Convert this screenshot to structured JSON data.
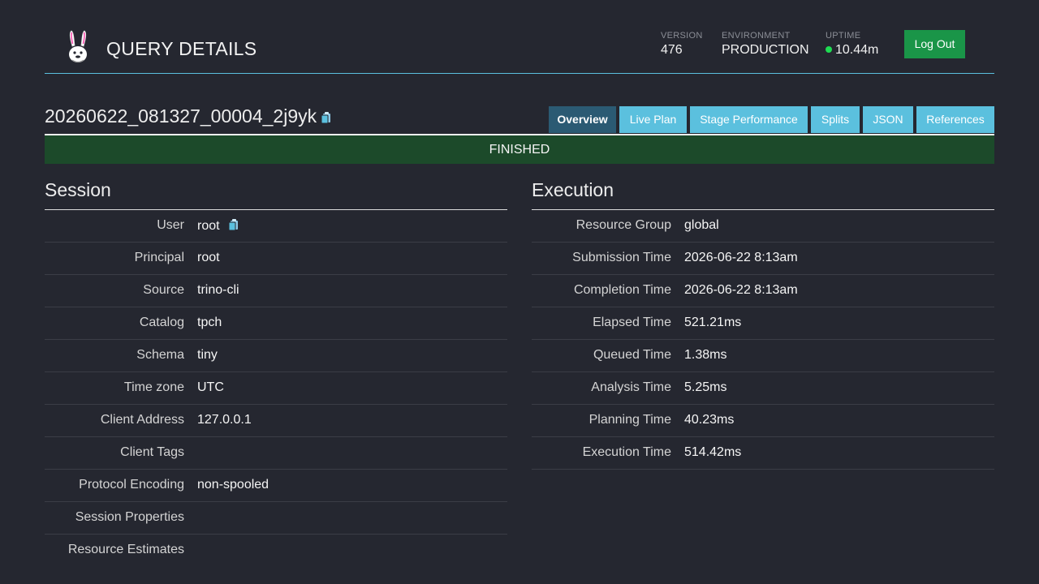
{
  "header": {
    "title": "QUERY DETAILS",
    "version_label": "VERSION",
    "version": "476",
    "environment_label": "ENVIRONMENT",
    "environment": "PRODUCTION",
    "uptime_label": "UPTIME",
    "uptime": "10.44m",
    "logout_label": "Log Out"
  },
  "query": {
    "id": "20260622_081327_00004_2j9yk",
    "state": "FINISHED"
  },
  "tabs": [
    {
      "label": "Overview",
      "active": true
    },
    {
      "label": "Live Plan",
      "active": false
    },
    {
      "label": "Stage Performance",
      "active": false
    },
    {
      "label": "Splits",
      "active": false
    },
    {
      "label": "JSON",
      "active": false
    },
    {
      "label": "References",
      "active": false
    }
  ],
  "session": {
    "title": "Session",
    "rows": [
      {
        "label": "User",
        "value": "root"
      },
      {
        "label": "Principal",
        "value": "root"
      },
      {
        "label": "Source",
        "value": "trino-cli"
      },
      {
        "label": "Catalog",
        "value": "tpch"
      },
      {
        "label": "Schema",
        "value": "tiny"
      },
      {
        "label": "Time zone",
        "value": "UTC"
      },
      {
        "label": "Client Address",
        "value": "127.0.0.1"
      },
      {
        "label": "Client Tags",
        "value": ""
      },
      {
        "label": "Protocol Encoding",
        "value": "non-spooled"
      },
      {
        "label": "Session Properties",
        "value": ""
      },
      {
        "label": "Resource Estimates",
        "value": ""
      }
    ]
  },
  "execution": {
    "title": "Execution",
    "rows": [
      {
        "label": "Resource Group",
        "value": "global"
      },
      {
        "label": "Submission Time",
        "value": "2026-06-22 8:13am"
      },
      {
        "label": "Completion Time",
        "value": "2026-06-22 8:13am"
      },
      {
        "label": "Elapsed Time",
        "value": "521.21ms"
      },
      {
        "label": "Queued Time",
        "value": "1.38ms"
      },
      {
        "label": "Analysis Time",
        "value": "5.25ms"
      },
      {
        "label": "Planning Time",
        "value": "40.23ms"
      },
      {
        "label": "Execution Time",
        "value": "514.42ms"
      }
    ]
  },
  "colors": {
    "background": "#252730",
    "accent": "#5bc0de",
    "active_tab": "#2b5a73",
    "finished": "#1c4a2a",
    "logout": "#1a9548",
    "uptime_dot": "#1edc52"
  },
  "icons": {
    "logo": "bunny-logo-icon",
    "copy": "clipboard-copy-icon"
  }
}
